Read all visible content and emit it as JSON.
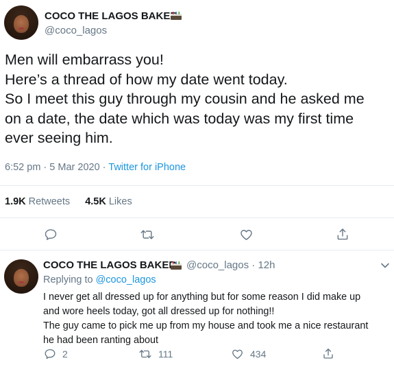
{
  "main_tweet": {
    "author_name": "COCO THE LAGOS BAKER",
    "author_handle": "@coco_lagos",
    "text_lines": [
      "Men will embarrass you!",
      "Here’s a thread of how my date went today.",
      "So I meet this guy through my cousin and he asked me",
      "on a date, the date which was today was my first time",
      "ever seeing him."
    ],
    "time": "6:52 pm",
    "separator": " · ",
    "date": "5 Mar 2020",
    "source": "Twitter for iPhone",
    "retweets_count": "1.9K",
    "retweets_label": "Retweets",
    "likes_count": "4.5K",
    "likes_label": "Likes"
  },
  "reply_tweet": {
    "author_name": "COCO THE LAGOS BAKER",
    "author_handle": "@coco_lagos",
    "separator": " · ",
    "time_ago": "12h",
    "replying_label": "Replying to",
    "replying_to": "@coco_lagos",
    "text_lines": [
      "I never get all dressed up for anything but for some reason I did make up",
      "and wore heels today, got all dressed up for nothing!!",
      "The guy came to pick me up from my house and took me a nice restaurant",
      "he had been ranting about"
    ],
    "reply_count": "2",
    "retweet_count": "111",
    "like_count": "434"
  },
  "icons": {
    "avatar": "avatar-photo",
    "badge": "cake-icon",
    "reply": "reply-icon",
    "retweet": "retweet-icon",
    "like": "heart-icon",
    "share": "share-icon",
    "more": "chevron-down-icon"
  },
  "colors": {
    "text": "#14171a",
    "muted": "#657786",
    "link": "#1b95e0",
    "border": "#e6ecf0"
  }
}
